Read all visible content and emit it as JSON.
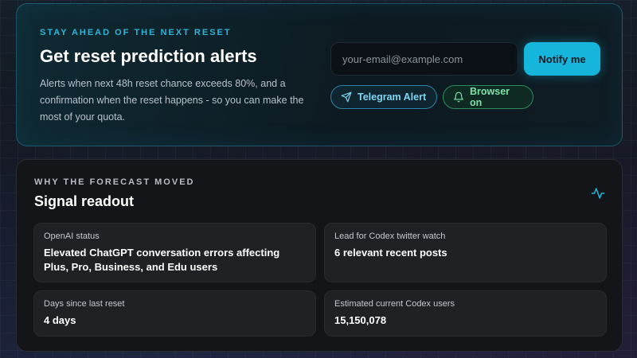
{
  "alert": {
    "eyebrow": "STAY AHEAD OF THE NEXT RESET",
    "title": "Get reset prediction alerts",
    "description": "Alerts when next 48h reset chance exceeds 80%, and a confirmation when the reset happens - so you can make the most of your quota.",
    "email_placeholder": "your-email@example.com",
    "notify_label": "Notify me",
    "telegram_label": "Telegram Alert",
    "telegram_icon": "send-icon",
    "browser_label": "Browser on",
    "browser_icon": "bell-icon"
  },
  "signal": {
    "eyebrow": "WHY THE FORECAST MOVED",
    "title": "Signal readout",
    "icon": "activity-pulse-icon",
    "tiles": [
      {
        "label": "OpenAI status",
        "value": "Elevated ChatGPT conversation errors affecting Plus, Pro, Business, and Edu users"
      },
      {
        "label": "Lead for Codex twitter watch",
        "value": "6 relevant recent posts"
      },
      {
        "label": "Days since last reset",
        "value": "4 days"
      },
      {
        "label": "Estimated current Codex users",
        "value": "15,150,078"
      }
    ]
  },
  "colors": {
    "accent": "#16b6dc",
    "telegram": "#7fd6f2",
    "browser": "#7be3a8"
  }
}
